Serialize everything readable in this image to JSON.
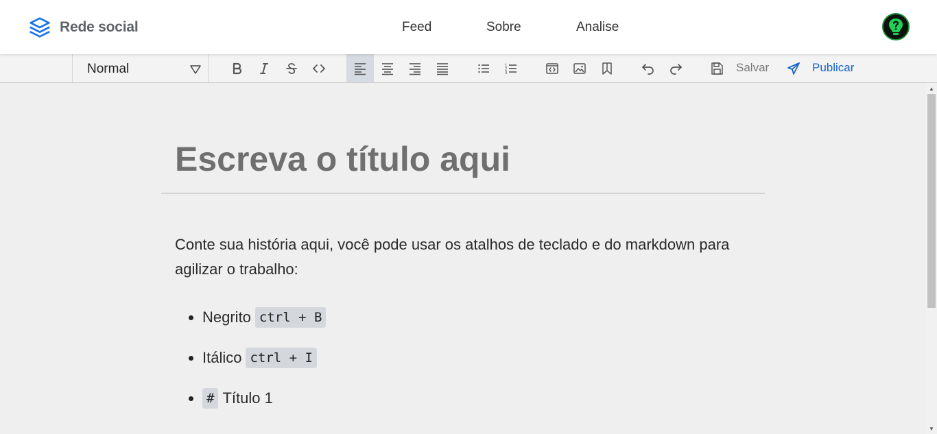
{
  "brand": {
    "name": "Rede social",
    "icon": "layers-icon",
    "color": "#1a73e8"
  },
  "nav": {
    "items": [
      "Feed",
      "Sobre",
      "Analise"
    ]
  },
  "toolbar": {
    "block_style": "Normal",
    "save_label": "Salvar",
    "publish_label": "Publicar",
    "publish_color": "#1766c9",
    "active_button": "align-left"
  },
  "editor": {
    "title_placeholder": "Escreva o título aqui",
    "intro": "Conte sua história aqui, você pode usar os atalhos de teclado e do markdown para agilizar o trabalho:",
    "shortcuts": [
      {
        "label": "Negrito",
        "key": "ctrl + B"
      },
      {
        "label": "Itálico",
        "key": "ctrl + I"
      },
      {
        "key": "#",
        "label": "Título 1"
      }
    ]
  }
}
